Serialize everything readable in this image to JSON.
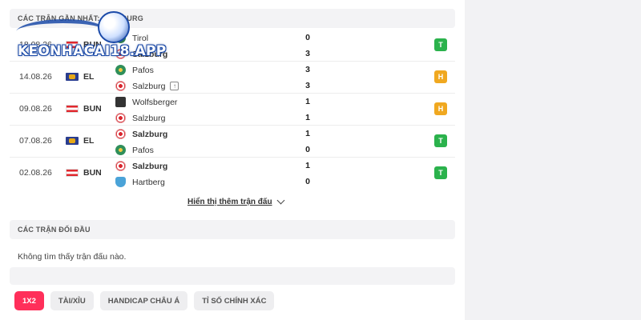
{
  "sections": {
    "recent_title": "CÁC TRẬN GẦN NHẤT: SALZBURG",
    "h2h_title": "CÁC TRẬN ĐỐI ĐẦU",
    "no_h2h": "Không tìm thấy trận đấu nào."
  },
  "matches": [
    {
      "date": "18.08.26",
      "comp": "BUN",
      "home": "Tirol",
      "away": "Salzburg",
      "home_score": "0",
      "away_score": "3",
      "result": "T",
      "winner": "away"
    },
    {
      "date": "14.08.26",
      "comp": "EL",
      "home": "Pafos",
      "away": "Salzburg",
      "home_score": "3",
      "away_score": "3",
      "result": "H",
      "winner": "none"
    },
    {
      "date": "09.08.26",
      "comp": "BUN",
      "home": "Wolfsberger",
      "away": "Salzburg",
      "home_score": "1",
      "away_score": "1",
      "result": "H",
      "winner": "none"
    },
    {
      "date": "07.08.26",
      "comp": "EL",
      "home": "Salzburg",
      "away": "Pafos",
      "home_score": "1",
      "away_score": "0",
      "result": "T",
      "winner": "home"
    },
    {
      "date": "02.08.26",
      "comp": "BUN",
      "home": "Salzburg",
      "away": "Hartberg",
      "home_score": "1",
      "away_score": "0",
      "result": "T",
      "winner": "home"
    }
  ],
  "show_more": "Hiển thị thêm trận đấu",
  "tabs": [
    "1X2",
    "TÀI/XỈU",
    "HANDICAP CHÂU Á",
    "TỈ SỐ CHÍNH XÁC"
  ],
  "watermark": "KEONHACAI18.APP",
  "colors": {
    "win": "#2bb24c",
    "draw": "#f0a820",
    "active_tab": "#ff2f5a"
  }
}
